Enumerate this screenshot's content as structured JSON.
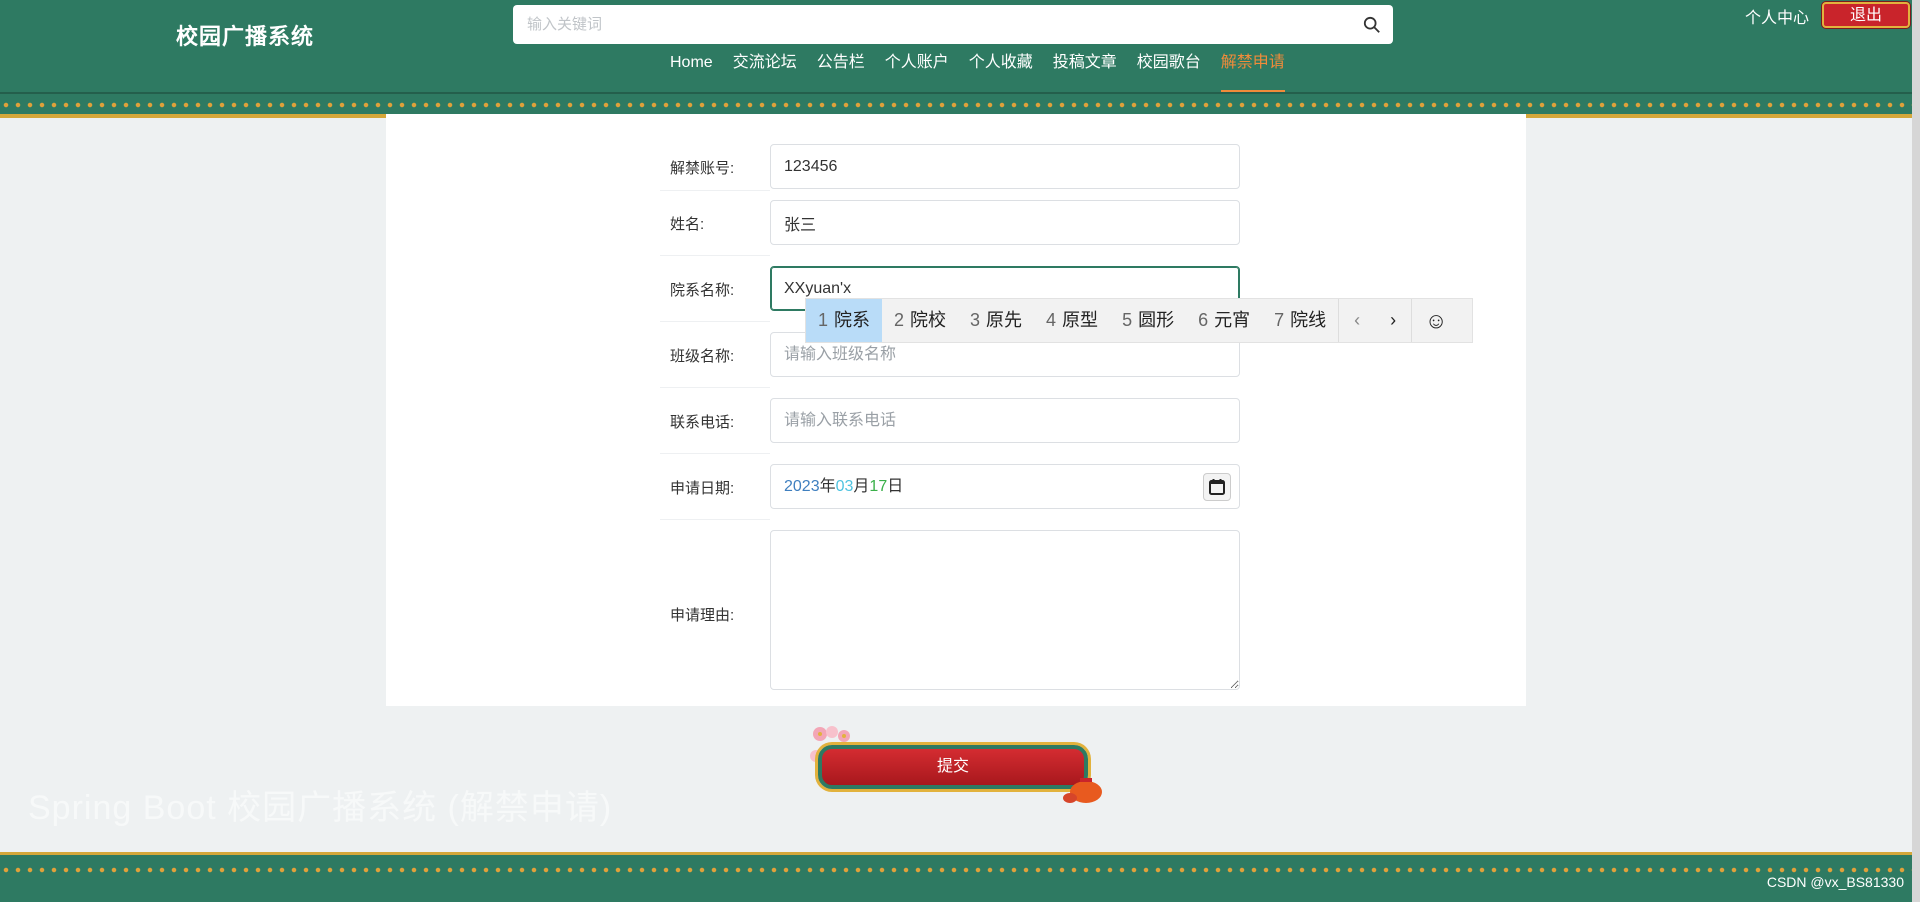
{
  "header": {
    "site_title": "校园广播系统",
    "search_placeholder": "输入关键词",
    "user_center": "个人中心",
    "logout": "退出",
    "nav": [
      {
        "label": "Home",
        "active": false
      },
      {
        "label": "交流论坛",
        "active": false
      },
      {
        "label": "公告栏",
        "active": false
      },
      {
        "label": "个人账户",
        "active": false
      },
      {
        "label": "个人收藏",
        "active": false
      },
      {
        "label": "投稿文章",
        "active": false
      },
      {
        "label": "校园歌台",
        "active": false
      },
      {
        "label": "解禁申请",
        "active": true
      }
    ]
  },
  "form": {
    "account": {
      "label": "解禁账号:",
      "value": "123456"
    },
    "name": {
      "label": "姓名:",
      "value": "张三"
    },
    "department": {
      "label": "院系名称:",
      "value": "XXyuan'x"
    },
    "class_name": {
      "label": "班级名称:",
      "placeholder": "请输入班级名称"
    },
    "phone": {
      "label": "联系电话:",
      "placeholder": "请输入联系电话"
    },
    "date": {
      "label": "申请日期:",
      "year": "2023",
      "year_unit": "年",
      "month": "03",
      "month_unit": "月",
      "day": "17",
      "day_unit": "日"
    },
    "reason": {
      "label": "申请理由:",
      "value": ""
    },
    "submit": "提交"
  },
  "ime": {
    "candidates": [
      {
        "num": "1",
        "text": "院系"
      },
      {
        "num": "2",
        "text": "院校"
      },
      {
        "num": "3",
        "text": "原先"
      },
      {
        "num": "4",
        "text": "原型"
      },
      {
        "num": "5",
        "text": "圆形"
      },
      {
        "num": "6",
        "text": "元宵"
      },
      {
        "num": "7",
        "text": "院线"
      }
    ],
    "prev": "‹",
    "next": "›",
    "emoji": "☺"
  },
  "faint_text": "Spring Boot 校园广播系统 (解禁申请)",
  "watermark": "CSDN @vx_BS81330"
}
